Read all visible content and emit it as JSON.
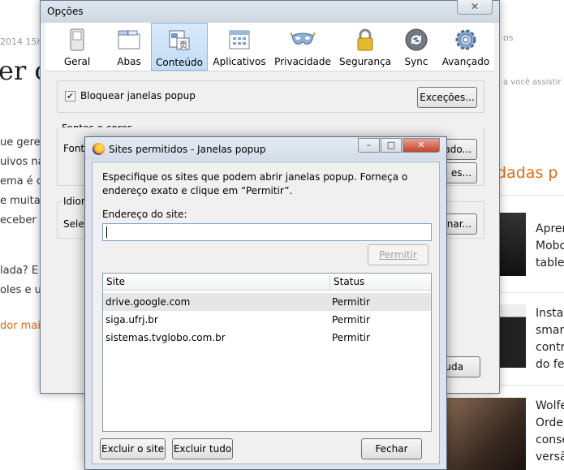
{
  "background_page": {
    "date_fragment": "2014 15h5",
    "big_text": "er o l",
    "lines": [
      "ue gere",
      "uivos na",
      "ema é c",
      "e muita",
      "eceber p",
      "",
      "lada? E",
      "oles e ut"
    ],
    "orange_link": "dor mai",
    "right_top": "os",
    "right_sub": "a você assistir on",
    "recommended": "ndadas p",
    "articles": [
      [
        "Apren",
        "Mobo",
        "tablet"
      ],
      [
        "Instag",
        "smart",
        "contro",
        "do fe"
      ],
      [
        "Wolfe",
        "Order",
        "conse",
        "versã"
      ]
    ],
    "colors": {
      "orange": "#e06a10"
    }
  },
  "options_window": {
    "title": "Opções",
    "close_glyph": "✕",
    "tabs": [
      {
        "label": "Geral",
        "icon": "switch-icon"
      },
      {
        "label": "Abas",
        "icon": "tabs-icon"
      },
      {
        "label": "Conteúdo",
        "icon": "content-icon",
        "selected": true
      },
      {
        "label": "Aplicativos",
        "icon": "applications-icon"
      },
      {
        "label": "Privacidade",
        "icon": "mask-icon"
      },
      {
        "label": "Segurança",
        "icon": "lock-icon"
      },
      {
        "label": "Sync",
        "icon": "sync-icon"
      },
      {
        "label": "Avançado",
        "icon": "gear-icon"
      }
    ],
    "block_popups_label": "Bloquear janelas popup",
    "block_popups_checked": true,
    "exceptions_button": "Exceções...",
    "fonts_section_title": "Fontes e cores",
    "fonts_label_fragment": "Fonte",
    "advanced_button_fragment": "ado...",
    "colors_button_fragment": "es...",
    "language_label_fragment": "Idiom",
    "select_label_fragment": "Selec",
    "choose_button_fragment": "onar...",
    "help_button_fragment": "uda"
  },
  "sites_dialog": {
    "title": "Sites permitidos - Janelas popup",
    "controls": {
      "minimize": "–",
      "maximize": "□",
      "close": "✕"
    },
    "description": "Especifique os sites que podem abrir janelas popup. Forneça o endereço exato e clique em “Permitir”.",
    "address_label": "Endereço do site:",
    "address_value": "",
    "allow_button": "Permitir",
    "columns": {
      "site": "Site",
      "status": "Status"
    },
    "rows": [
      {
        "site": "drive.google.com",
        "status": "Permitir",
        "selected": true
      },
      {
        "site": "siga.ufrj.br",
        "status": "Permitir"
      },
      {
        "site": "sistemas.tvglobo.com.br",
        "status": "Permitir"
      }
    ],
    "remove_site_button": "Excluir o site",
    "remove_all_button": "Excluir tudo",
    "close_button": "Fechar"
  }
}
